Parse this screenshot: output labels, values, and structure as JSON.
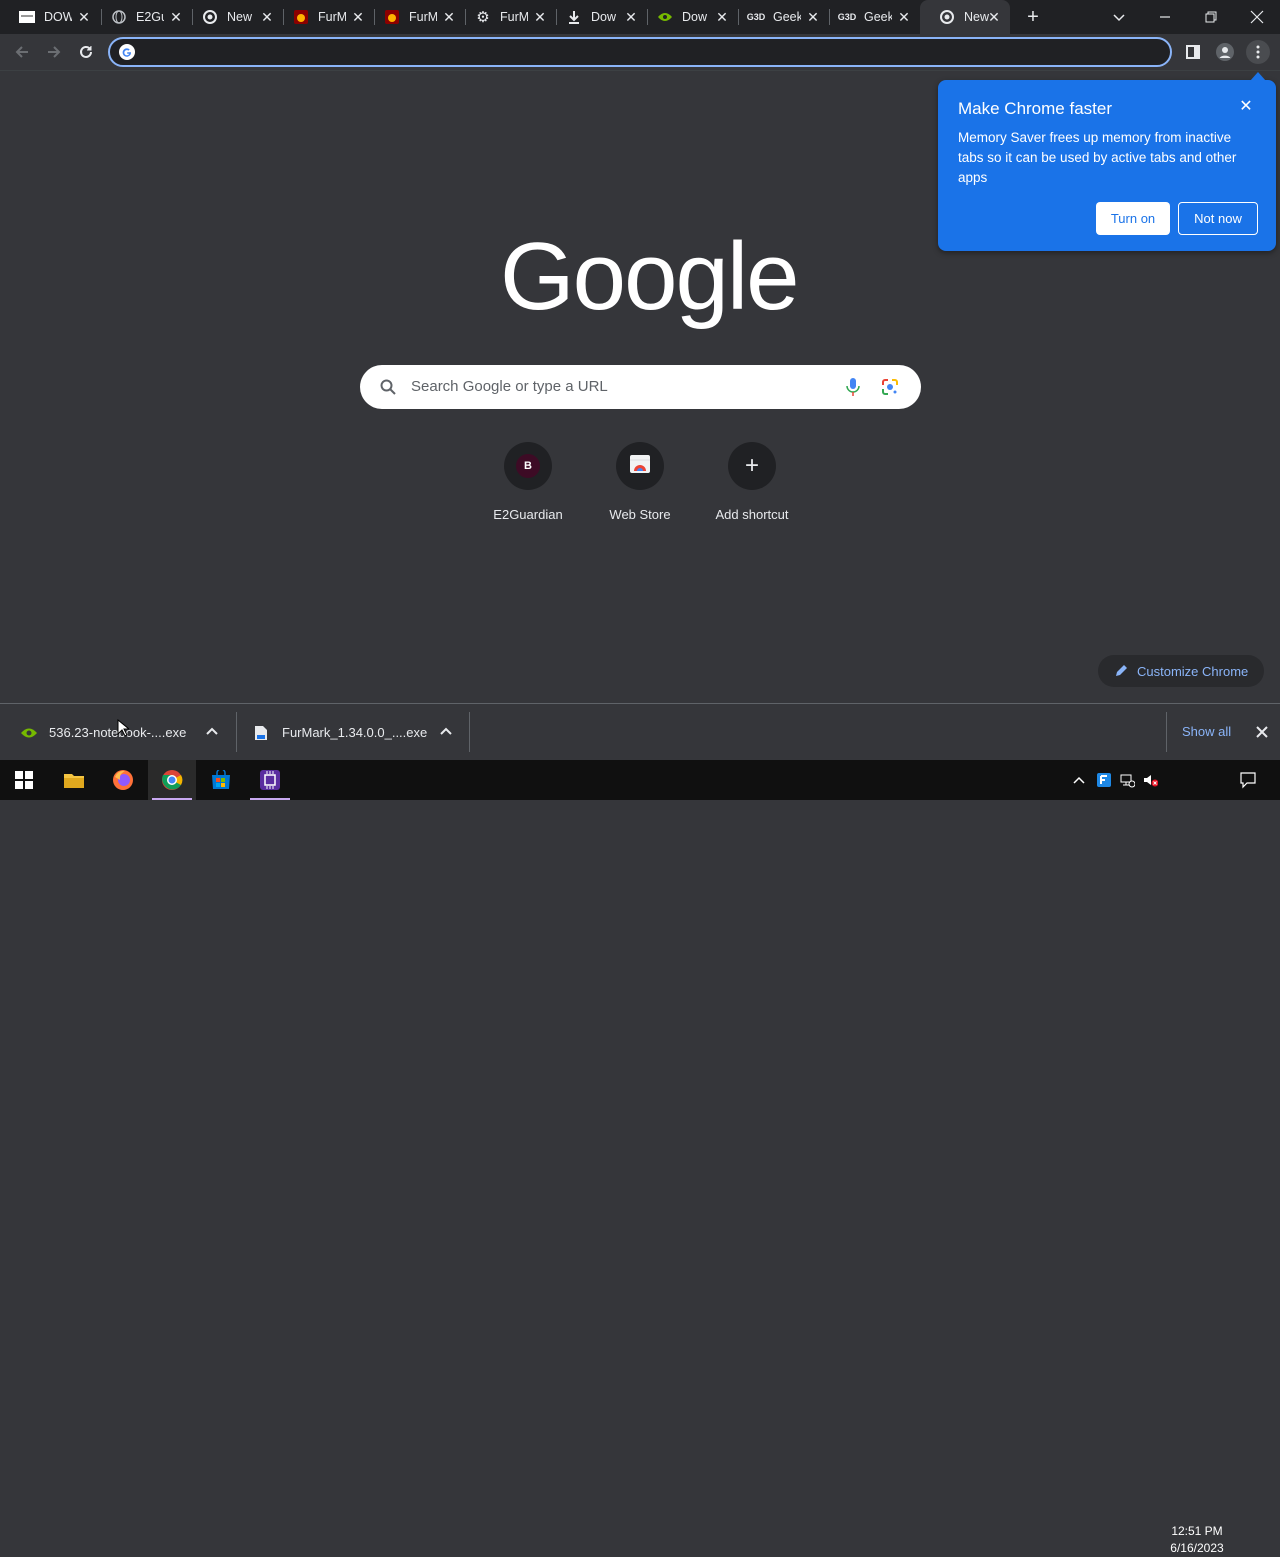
{
  "tabs": [
    {
      "title": "DOW",
      "icon": "page-favicon-icon"
    },
    {
      "title": "E2Gu",
      "icon": "globe-icon"
    },
    {
      "title": "New",
      "icon": "chrome-icon"
    },
    {
      "title": "FurM",
      "icon": "furmark-icon"
    },
    {
      "title": "FurM",
      "icon": "furmark-icon"
    },
    {
      "title": "FurM",
      "icon": "gear-icon"
    },
    {
      "title": "Dow",
      "icon": "download-icon"
    },
    {
      "title": "Dow",
      "icon": "nvidia-icon"
    },
    {
      "title": "Geek",
      "icon": "geekbench-icon"
    },
    {
      "title": "Geek",
      "icon": "geekbench-icon"
    },
    {
      "title": "New",
      "icon": "chrome-icon"
    }
  ],
  "omnibox": {
    "value": "",
    "placeholder": ""
  },
  "popup": {
    "title": "Make Chrome faster",
    "body": "Memory Saver frees up memory from inactive tabs so it can be used by active tabs and other apps",
    "primary": "Turn on",
    "secondary": "Not now"
  },
  "logo_text": "Google",
  "search": {
    "placeholder": "Search Google or type a URL"
  },
  "shortcuts": [
    {
      "label": "E2Guardian",
      "icon_letter": "B"
    },
    {
      "label": "Web Store"
    },
    {
      "label": "Add shortcut"
    }
  ],
  "customize_label": "Customize Chrome",
  "downloads": {
    "items": [
      {
        "name": "536.23-notebook-....exe"
      },
      {
        "name": "FurMark_1.34.0.0_....exe"
      }
    ],
    "show_all": "Show all"
  },
  "clock": {
    "time": "12:51 PM",
    "date": "6/16/2023"
  },
  "colors": {
    "accent": "#1a73e8",
    "link": "#8ab4f8",
    "background": "#35363a"
  }
}
